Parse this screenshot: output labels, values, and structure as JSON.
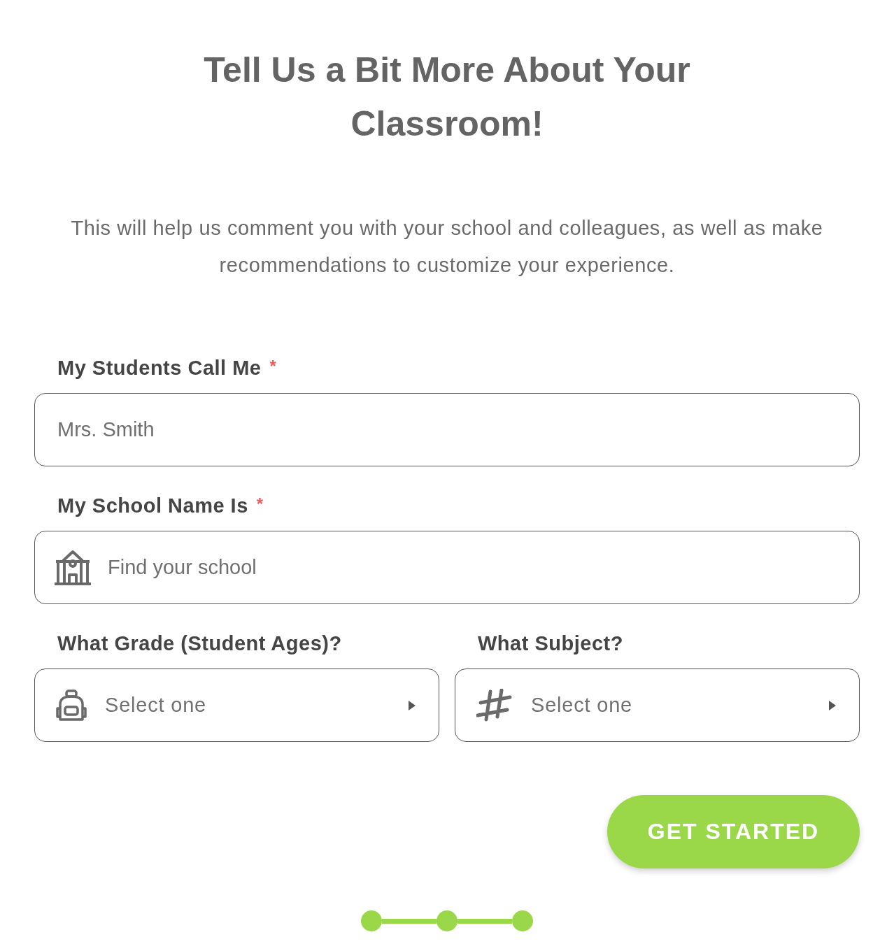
{
  "title": "Tell Us a Bit More About Your Classroom!",
  "subtitle": "This will help us comment you with your school and colleagues, as well as make recommendations to customize your experience.",
  "fields": [
    {
      "kind": "text",
      "label": "My Students Call Me",
      "required": true,
      "required_mark": "*",
      "placeholder": "Mrs. Smith"
    },
    {
      "kind": "search",
      "label": "My School Name Is",
      "required": true,
      "required_mark": "*",
      "placeholder": "Find your school"
    }
  ],
  "selects": [
    {
      "kind": "grade",
      "label": "What Grade (Student Ages)?",
      "placeholder": "Select one"
    },
    {
      "kind": "subject",
      "label": "What Subject?",
      "placeholder": "Select one"
    }
  ],
  "button": "GET STARTED",
  "steps": [
    {
      "done": true
    },
    {
      "done": true
    },
    {
      "done": true
    }
  ]
}
